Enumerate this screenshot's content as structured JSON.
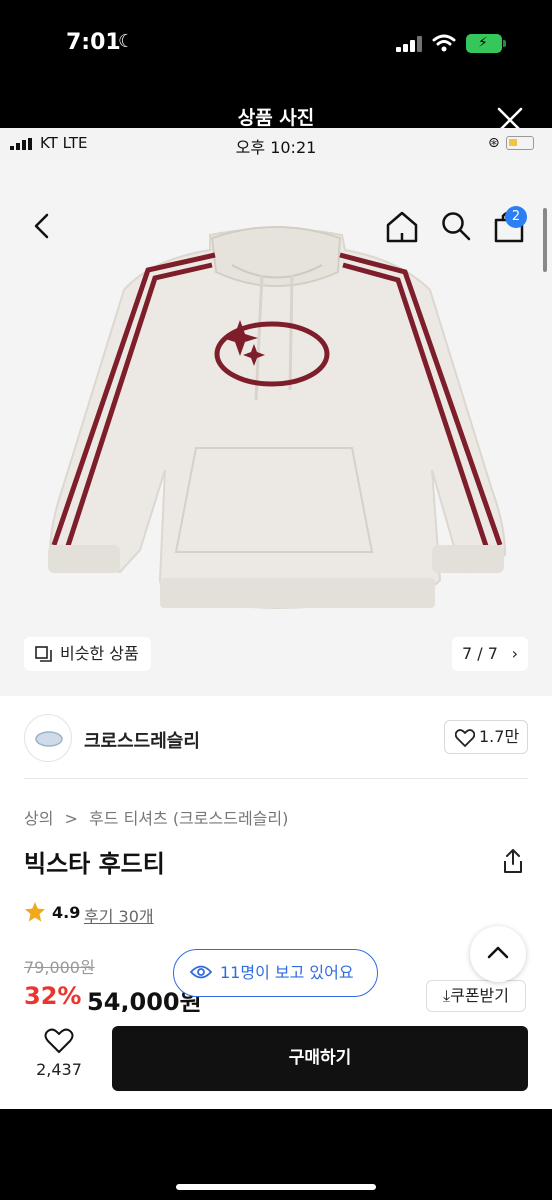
{
  "outer_status": {
    "time": "7:01"
  },
  "viewer": {
    "title": "상품 사진"
  },
  "inner_status": {
    "carrier": "KT  LTE",
    "time": "오후 10:21"
  },
  "header": {
    "cart_count": "2"
  },
  "gallery": {
    "similar_label": "비슷한 상품",
    "page_indicator": "7 / 7"
  },
  "brand": {
    "name": "크로스드레슬리",
    "likes": "1.7만"
  },
  "product": {
    "breadcrumb": [
      "상의",
      ">",
      "후드 티셔츠 (크로스드레슬리)"
    ],
    "title": "빅스타 후드티",
    "rating": "4.9",
    "reviews": "후기 30개",
    "original_price": "79,000원",
    "discount": "32%",
    "price": "54,000원",
    "coupon_label": "쿠폰받기",
    "viewers_notice": "11명이 보고 있어요"
  },
  "bottom_bar": {
    "wish_count": "2,437",
    "buy_label": "구매하기"
  },
  "colors": {
    "accent_blue": "#2f6ce0",
    "discount_red": "#e8352e",
    "star": "#f0a91b",
    "buy_bg": "#111111"
  }
}
